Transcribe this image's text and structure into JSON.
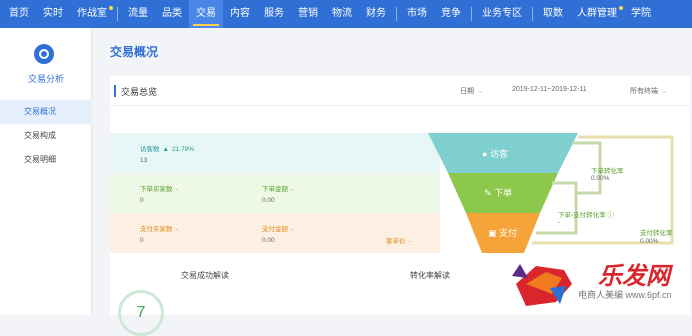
{
  "topnav": {
    "items": [
      "首页",
      "实时",
      "作战室",
      "流量",
      "品类",
      "交易",
      "内容",
      "服务",
      "营销",
      "物流",
      "财务",
      "市场",
      "竞争",
      "业务专区",
      "取数",
      "人群管理",
      "学院"
    ],
    "active_index": 5
  },
  "sidebar": {
    "title": "交易分析",
    "items": [
      "交易概况",
      "交易构成",
      "交易明细"
    ],
    "active_index": 0
  },
  "page": {
    "title": "交易概况",
    "panel_title": "交易总览",
    "period_select": "日期",
    "date_range": "2019-12-11~2019-12-11",
    "terminal_select": "所有终端"
  },
  "metrics": {
    "visitors_label": "访客数",
    "visitors_change": "21.79%",
    "visitors_value": "13",
    "order_buyers_label": "下单买家数",
    "order_buyers_value": "0",
    "order_amount_label": "下单金额",
    "order_amount_value": "0.00",
    "pay_buyers_label": "支付买家数",
    "pay_buyers_value": "0",
    "pay_amount_label": "支付金额",
    "pay_amount_value": "0.00",
    "unit_price_label": "客单价",
    "dash": "-"
  },
  "funnel": {
    "stage1": "访客",
    "stage2": "下单",
    "stage3": "支付",
    "order_rate_label": "下单转化率",
    "order_rate_value": "0.00%",
    "order_pay_rate_label": "下单-支付转化率",
    "order_pay_rate_value": "-",
    "pay_rate_label": "支付转化率",
    "pay_rate_value": "0.00%"
  },
  "bottom": {
    "left_title": "交易成功解读",
    "right_title": "转化率解读",
    "badge": "7"
  },
  "watermark": {
    "brand": "乐发网",
    "site": "电商人美编 www.6pf.cn"
  },
  "colors": {
    "nav_blue": "#2f6fd6",
    "visit_teal": "#7fcfd0",
    "order_green": "#8cc84b",
    "pay_orange": "#f5a43a"
  }
}
